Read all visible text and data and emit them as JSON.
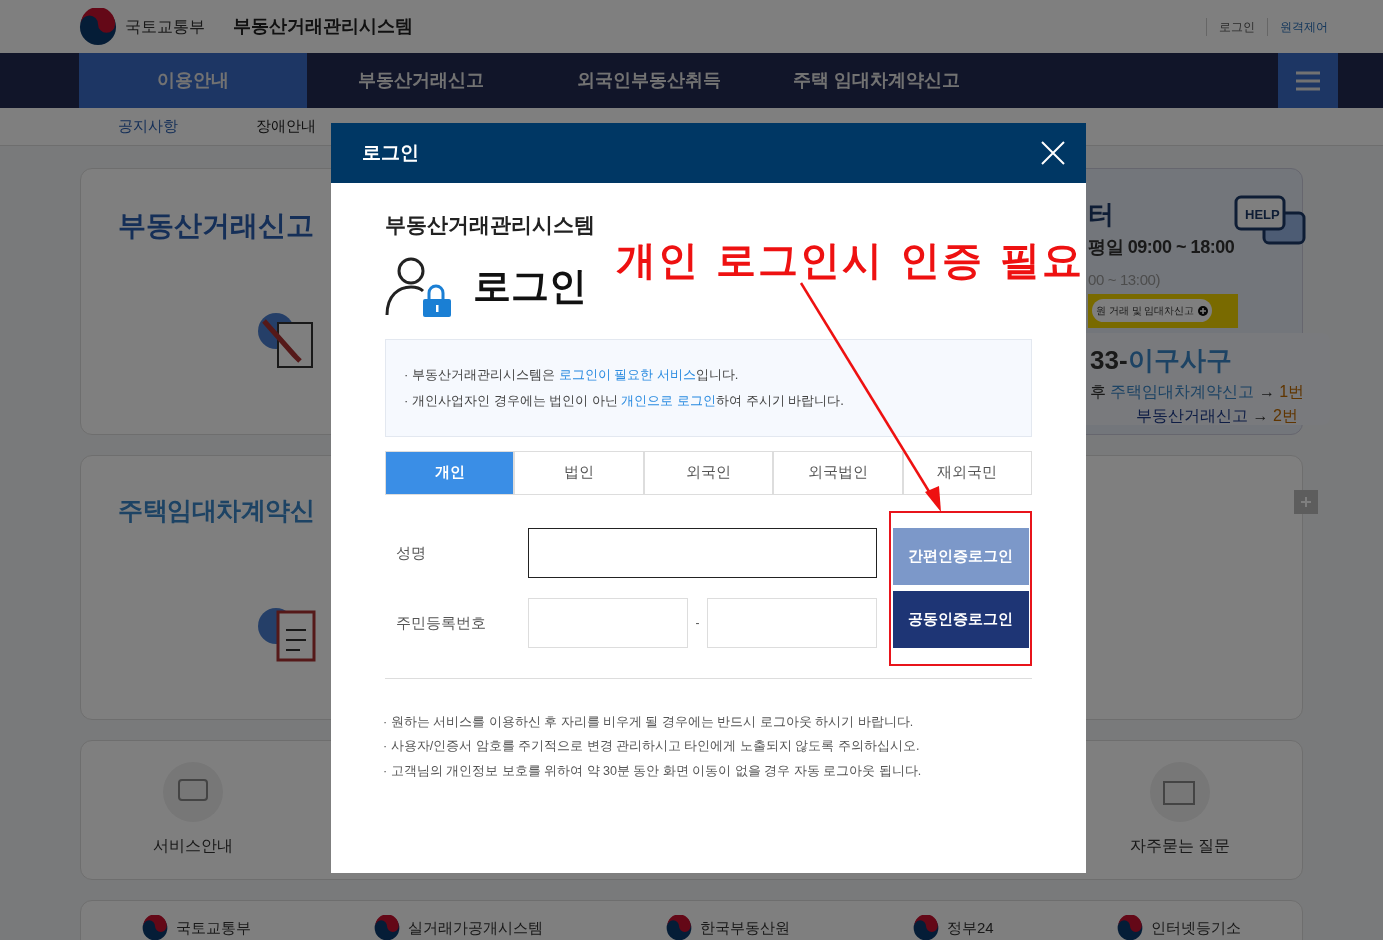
{
  "header": {
    "ministry": "국토교통부",
    "system": "부동산거래관리시스템",
    "links": [
      {
        "label": "로그인",
        "kind": "plain"
      },
      {
        "label": "원격제어",
        "kind": "accent"
      }
    ]
  },
  "nav": {
    "items": [
      {
        "label": "이용안내",
        "selected": true
      },
      {
        "label": "부동산거래신고",
        "selected": false
      },
      {
        "label": "외국인부동산취득",
        "selected": false
      },
      {
        "label": "주택 임대차계약신고",
        "selected": false
      }
    ]
  },
  "subnav": {
    "items": [
      {
        "label": "공지사항",
        "selected": true
      },
      {
        "label": "장애안내",
        "selected": false
      }
    ]
  },
  "cards": {
    "report_title": "부동산거래신고",
    "lease_title": "주택임대차계약신",
    "service": "서비스안내",
    "faq": "자주묻는 질문",
    "help": {
      "title": "터",
      "hours": "평일 09:00 ~ 18:00",
      "lunch": "00 ~ 13:00)",
      "banner": "원 거래 및 임대차신고",
      "help_icon": "HELP",
      "arrow": "→",
      "phone_prefix": "33-",
      "phone_word": "이구사구",
      "line1_prefix": "후",
      "line1_link": "주택임대차계약신고",
      "line1_num": "1번",
      "line2_link": "부동산거래신고",
      "line2_num": "2번"
    }
  },
  "footer": [
    "국토교통부",
    "실거래가공개시스템",
    "한국부동산원",
    "정부24",
    "인터넷등기소"
  ],
  "modal": {
    "title": "로그인",
    "system": "부동산거래관리시스템",
    "heading": "로그인",
    "bullet": "·",
    "info": [
      {
        "before": "부동산거래관리시스템은 ",
        "accent": "로그인이 필요한 서비스",
        "after": "입니다."
      },
      {
        "before": "개인사업자인 경우에는 법인이 아닌 ",
        "accent": "개인으로 로그인",
        "after": "하여 주시기 바랍니다."
      }
    ],
    "tabs": [
      {
        "label": "개인",
        "selected": true
      },
      {
        "label": "법인",
        "selected": false
      },
      {
        "label": "외국인",
        "selected": false
      },
      {
        "label": "외국법인",
        "selected": false
      },
      {
        "label": "재외국민",
        "selected": false
      }
    ],
    "name_label": "성명",
    "id_label": "주민등록번호",
    "id_separator": "-",
    "buttons": [
      {
        "label": "간편인증로그인",
        "kind": "light"
      },
      {
        "label": "공동인증로그인",
        "kind": "dark"
      }
    ],
    "notes": [
      "원하는 서비스를 이용하신 후 자리를 비우게 될 경우에는 반드시 로그아웃 하시기 바랍니다.",
      "사용자/인증서 암호를 주기적으로 변경 관리하시고 타인에게 노출되지 않도록 주의하십시오.",
      "고객님의 개인정보 보호를 위하여 약 30분 동안 화면 이동이 없을 경우 자동 로그아웃 됩니다."
    ]
  },
  "annotation": {
    "text": "개인 로그인시 인증 필요"
  }
}
